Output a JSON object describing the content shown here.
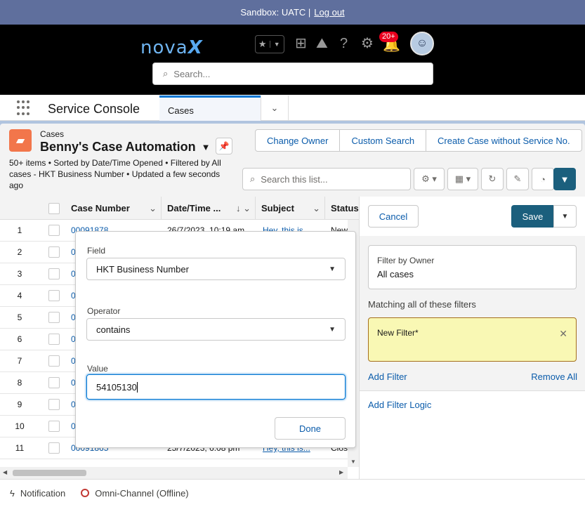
{
  "sandbox": {
    "text": "Sandbox: UATC |",
    "logout": "Log out"
  },
  "header": {
    "logo_text": "nova",
    "logo_x": "X",
    "notification_count": "20+",
    "search_placeholder": "Search..."
  },
  "nav": {
    "app_name": "Service Console",
    "tab_label": "Cases"
  },
  "list": {
    "object_label": "Cases",
    "list_name": "Benny's Case Automation",
    "meta": "50+ items • Sorted by Date/Time Opened • Filtered by All cases - HKT Business Number • Updated a few seconds ago",
    "buttons": [
      "Change Owner",
      "Custom Search",
      "Create Case without Service No."
    ],
    "search_placeholder": "Search this list...",
    "columns": [
      "Case Number",
      "Date/Time ...",
      "Subject",
      "Status"
    ]
  },
  "rows": [
    {
      "num": "1",
      "case": "00091878",
      "date": "26/7/2023, 10:19 am",
      "subject": "Hey, this is...",
      "status": "New"
    },
    {
      "num": "2",
      "case": "0",
      "date": "",
      "subject": "",
      "status": ""
    },
    {
      "num": "3",
      "case": "0",
      "date": "",
      "subject": "",
      "status": ""
    },
    {
      "num": "4",
      "case": "0",
      "date": "",
      "subject": "",
      "status": ""
    },
    {
      "num": "5",
      "case": "0",
      "date": "",
      "subject": "",
      "status": ""
    },
    {
      "num": "6",
      "case": "0",
      "date": "",
      "subject": "",
      "status": ""
    },
    {
      "num": "7",
      "case": "0",
      "date": "",
      "subject": "",
      "status": ""
    },
    {
      "num": "8",
      "case": "0",
      "date": "",
      "subject": "",
      "status": ""
    },
    {
      "num": "9",
      "case": "0",
      "date": "",
      "subject": "",
      "status": ""
    },
    {
      "num": "10",
      "case": "0",
      "date": "",
      "subject": "",
      "status": ""
    },
    {
      "num": "11",
      "case": "00091865",
      "date": "25/7/2023, 6:08 pm",
      "subject": "Hey, this is...",
      "status": "Clos"
    }
  ],
  "popover": {
    "field_label": "Field",
    "field_value": "HKT Business Number",
    "operator_label": "Operator",
    "operator_value": "contains",
    "value_label": "Value",
    "value": "54105130",
    "done": "Done"
  },
  "filters": {
    "cancel": "Cancel",
    "save": "Save",
    "owner_label": "Filter by Owner",
    "owner_value": "All cases",
    "matching": "Matching all of these filters",
    "new_filter": "New Filter*",
    "add_filter": "Add Filter",
    "remove_all": "Remove All",
    "add_logic": "Add Filter Logic"
  },
  "utility": {
    "notification": "Notification",
    "omni": "Omni-Channel (Offline)"
  },
  "colors": {
    "sandbox_bar": "#5f6f9d",
    "brand": "#1b5f7d",
    "link": "#0b5cab",
    "new_filter_bg": "#f9f8b4"
  }
}
